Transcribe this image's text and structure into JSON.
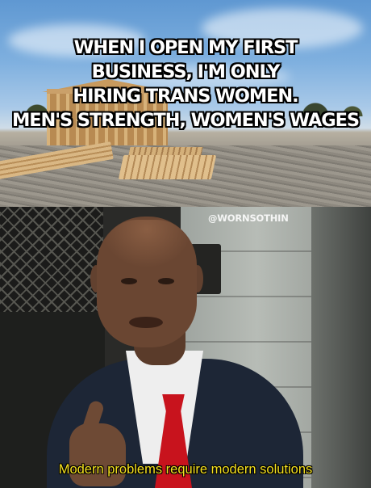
{
  "top_panel": {
    "caption_lines": [
      "WHEN I OPEN MY FIRST",
      "BUSINESS, I'M ONLY",
      "HIRING TRANS WOMEN.",
      "MEN'S STRENGTH, WOMEN'S WAGES"
    ],
    "caption_color": "#ffffff",
    "caption_outline": "#000000"
  },
  "bottom_panel": {
    "watermark": "@WORNSOTHIN",
    "caption": "Modern problems require modern solutions",
    "caption_color": "#f5e11f"
  }
}
